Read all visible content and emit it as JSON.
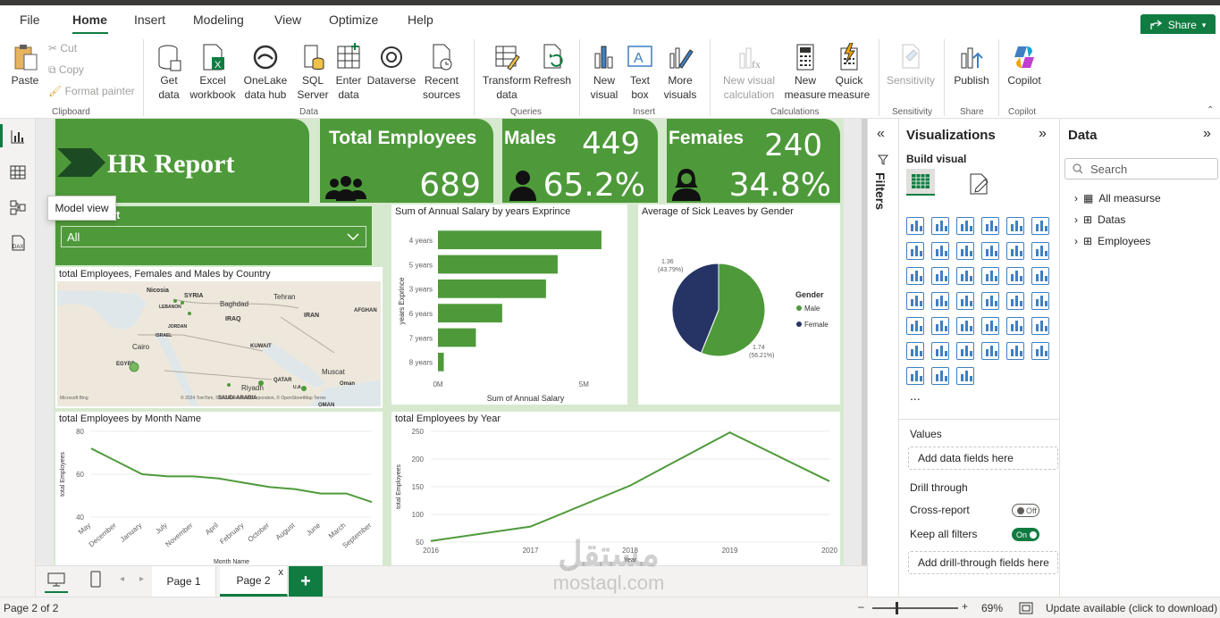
{
  "menu": {
    "file": "File",
    "home": "Home",
    "insert": "Insert",
    "modeling": "Modeling",
    "view": "View",
    "optimize": "Optimize",
    "help": "Help",
    "share": "Share"
  },
  "ribbon": {
    "paste": "Paste",
    "cut": "Cut",
    "copy": "Copy",
    "format_painter": "Format painter",
    "clipboard": "Clipboard",
    "get_data": "Get data",
    "excel": "Excel workbook",
    "onelake": "OneLake data hub",
    "sql": "SQL Server",
    "enter_data": "Enter data",
    "dataverse": "Dataverse",
    "recent": "Recent sources",
    "data": "Data",
    "transform": "Transform data",
    "refresh": "Refresh",
    "queries": "Queries",
    "new_visual": "New visual",
    "text_box": "Text box",
    "more_visuals": "More visuals",
    "insert": "Insert",
    "new_calc": "New visual calculation",
    "new_measure": "New measure",
    "quick_measure": "Quick measure",
    "calculations": "Calculations",
    "sensitivity_btn": "Sensitivity",
    "sensitivity": "Sensitivity",
    "publish": "Publish",
    "share": "Share",
    "copilot_btn": "Copilot",
    "copilot": "Copilot"
  },
  "tooltip": "Model view",
  "report": {
    "title": "HR Report",
    "total_employees_label": "Total Employees",
    "total_employees": "689",
    "males_label": "Males",
    "males": "449",
    "males_pct": "65.2%",
    "females_label": "Femaies",
    "females": "240",
    "females_pct": "34.8%",
    "slicer_label": "t",
    "slicer_value": "All",
    "map_title": "total Employees, Females and Males by Country",
    "map_labels": [
      "Nicosia",
      "SYRIA",
      "LEBANON",
      "Baghdad",
      "Tehran",
      "IRAQ",
      "IRAN",
      "AFGHAN",
      "JORDAN",
      "ISRAEL",
      "Cairo",
      "KUWAIT",
      "EGYPT",
      "Riyadh",
      "QATAR",
      "SAUDI ARABIA",
      "U.A.",
      "Muscat",
      "OMAN",
      "Oman"
    ],
    "map_footer": "© 2024 TomTom, © 2024 Microsoft Corporation, © OpenStreetMap Terms",
    "map_brand": "Microsoft Bing"
  },
  "chart_data": [
    {
      "type": "bar",
      "title": "Sum of Annual Salary by years Exprince",
      "xlabel": "Sum of Annual Salary",
      "ylabel": "years Exprince",
      "categories": [
        "4 years",
        "5 years",
        "3 years",
        "6 years",
        "7 years",
        "8 years"
      ],
      "values": [
        5.6,
        4.1,
        3.7,
        2.2,
        1.3,
        0.2
      ],
      "xticks": [
        "0M",
        "5M"
      ],
      "xlim": [
        0,
        6
      ]
    },
    {
      "type": "pie",
      "title": "Average of Sick Leaves by Gender",
      "legend_title": "Gender",
      "categories": [
        "Male",
        "Female"
      ],
      "values": [
        1.74,
        1.36
      ],
      "labels": [
        "1.74 (56.21%)",
        "1.36 (43.79%)"
      ],
      "colors": [
        "#4e9a3a",
        "#253464"
      ],
      "legend": "right"
    },
    {
      "type": "line",
      "title": "total Employees by Month Name",
      "xlabel": "Month Name",
      "ylabel": "total Employees",
      "categories": [
        "May",
        "December",
        "January",
        "July",
        "November",
        "April",
        "February",
        "October",
        "August",
        "June",
        "March",
        "September"
      ],
      "values": [
        72,
        66,
        60,
        59,
        59,
        58,
        56,
        54,
        53,
        51,
        51,
        47
      ],
      "ylim": [
        40,
        80
      ],
      "yticks": [
        "80",
        "60",
        "40"
      ]
    },
    {
      "type": "line",
      "title": "total Employees by Year",
      "xlabel": "Year",
      "ylabel": "total Employees",
      "categories": [
        "2016",
        "2017",
        "2018",
        "2019",
        "2020"
      ],
      "values": [
        52,
        78,
        152,
        248,
        160
      ],
      "ylim": [
        50,
        250
      ],
      "yticks": [
        "250",
        "200",
        "150",
        "100",
        "50"
      ]
    }
  ],
  "filters": "Filters",
  "viz": {
    "title": "Visualizations",
    "build": "Build visual",
    "values": "Values",
    "add_data": "Add data fields here",
    "drill": "Drill through",
    "cross": "Cross-report",
    "cross_state": "Off",
    "keep": "Keep all filters",
    "keep_state": "On",
    "add_drill": "Add drill-through fields here",
    "more": "..."
  },
  "data_pane": {
    "title": "Data",
    "search": "Search",
    "items": [
      "All measurse",
      "Datas",
      "Employees"
    ]
  },
  "tabs": {
    "page1": "Page 1",
    "page2": "Page 2",
    "close": "x",
    "add": "+"
  },
  "status": {
    "page": "Page 2 of 2",
    "zoom": "69%",
    "update": "Update available (click to download)"
  },
  "watermark": {
    "arabic": "مستقل",
    "latin": "mostaql.com"
  }
}
